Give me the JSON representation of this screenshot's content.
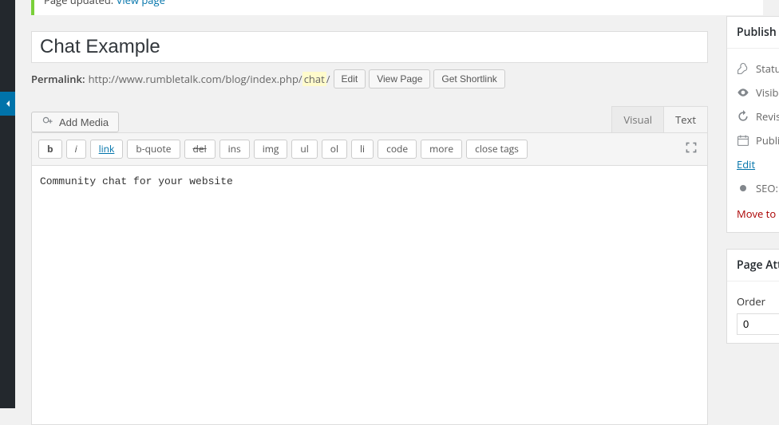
{
  "notice": {
    "text": "Page updated. ",
    "link": "View page"
  },
  "title": "Chat Example",
  "permalink": {
    "label": "Permalink:",
    "base": "http://www.rumbletalk.com/blog/index.php/",
    "slug": "chat",
    "trail": "/",
    "edit": "Edit",
    "view": "View Page",
    "shortlink": "Get Shortlink"
  },
  "add_media": "Add Media",
  "tabs": {
    "visual": "Visual",
    "text": "Text"
  },
  "quicktags": [
    "b",
    "i",
    "link",
    "b-quote",
    "del",
    "ins",
    "img",
    "ul",
    "ol",
    "li",
    "code",
    "more",
    "close tags"
  ],
  "editor_content": "Community chat for your website",
  "publish": {
    "heading": "Publish",
    "status_label": "Statu",
    "visibility_label": "Visib",
    "revisions_label": "Revis",
    "published_label": "Publi",
    "edit": "Edit",
    "seo_label": "SEO:",
    "move_trash": "Move to"
  },
  "attributes": {
    "heading": "Page Att",
    "order_label": "Order",
    "order_value": "0"
  }
}
